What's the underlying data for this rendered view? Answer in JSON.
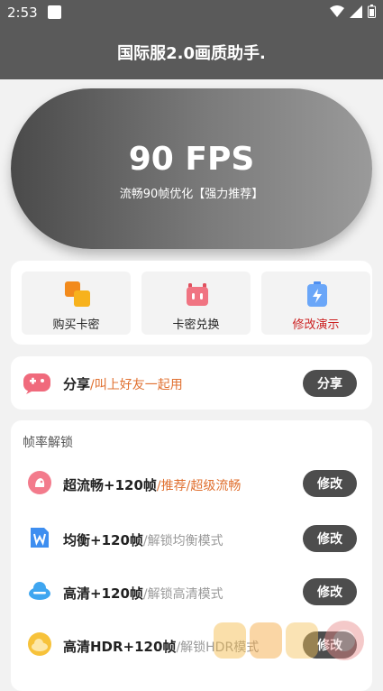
{
  "status_bar": {
    "time": "2:53"
  },
  "app_bar": {
    "title": "国际服2.0画质助手."
  },
  "hero": {
    "fps": "90 FPS",
    "subtitle": "流畅90帧优化【强力推荐】"
  },
  "actions": [
    {
      "label": "购买卡密",
      "color": "#222222"
    },
    {
      "label": "卡密兑换",
      "color": "#222222"
    },
    {
      "label": "修改演示",
      "color": "#cc2222"
    }
  ],
  "share": {
    "title": "分享",
    "hint": "/叫上好友一起用",
    "button": "分享"
  },
  "unlock": {
    "heading": "帧率解锁",
    "rows": [
      {
        "title": "超流畅+120帧",
        "hint": "/推荐/超级流畅",
        "button": "修改"
      },
      {
        "title": "均衡+120帧",
        "hint": "/解锁均衡模式",
        "button": "修改"
      },
      {
        "title": "高清+120帧",
        "hint": "/解锁高清模式",
        "button": "修改"
      },
      {
        "title": "高清HDR+120帧",
        "hint": "/解锁HDR模式",
        "button": "修改"
      }
    ]
  }
}
